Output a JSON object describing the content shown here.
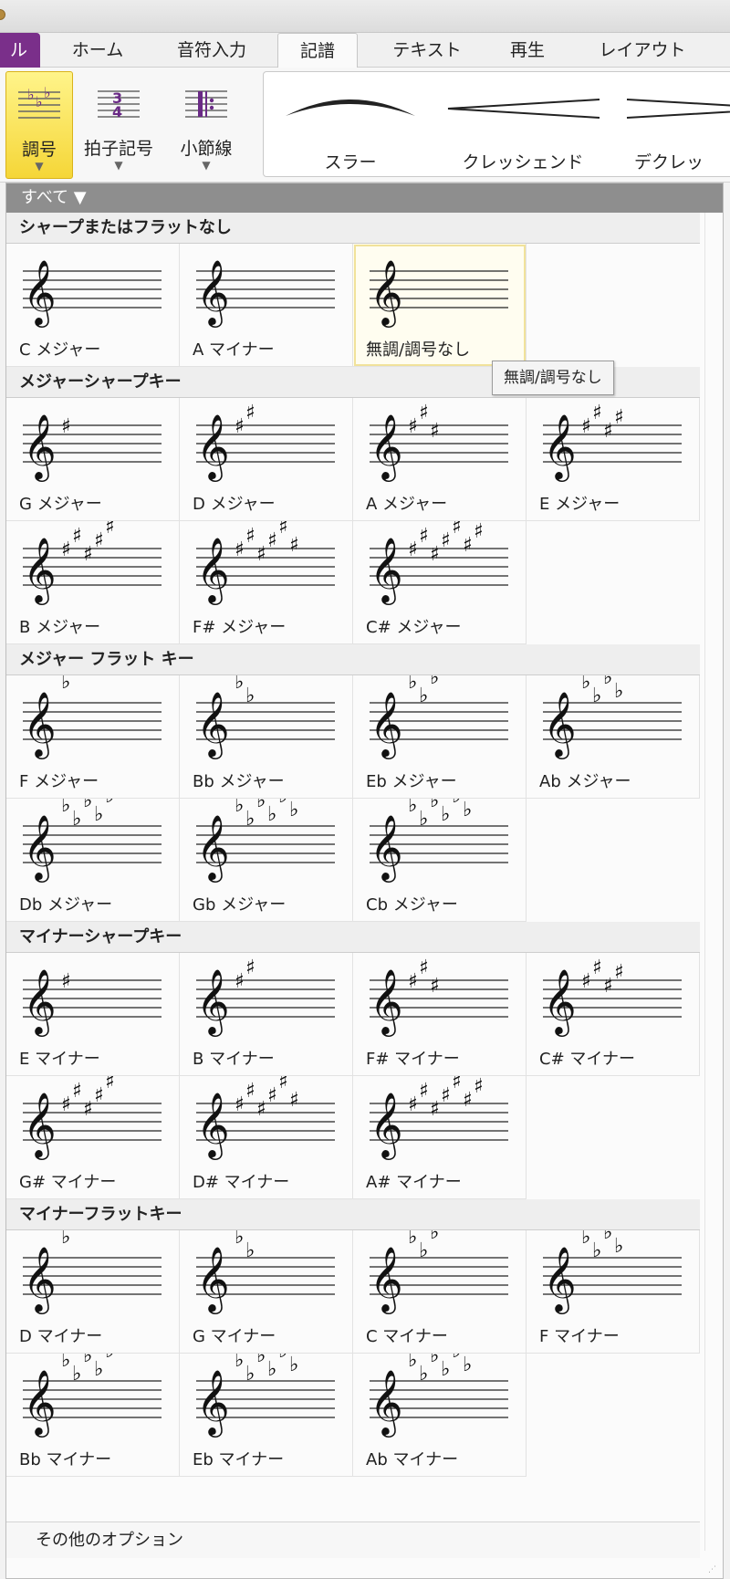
{
  "tabs": {
    "file_fragment": "ル",
    "home": "ホーム",
    "note_input": "音符入力",
    "notation": "記譜",
    "text": "テキスト",
    "play": "再生",
    "layout": "レイアウト"
  },
  "ribbon": {
    "key_signature": "調号",
    "time_signature": "拍子記号",
    "barline": "小節線",
    "slur": "スラー",
    "crescendo": "クレッシェンド",
    "decrescendo": "デクレッ"
  },
  "panel": {
    "filter_label": "すべて ▼",
    "tooltip": "無調/調号なし",
    "footer": "その他のオプション",
    "sections": [
      {
        "title": "シャープまたはフラットなし",
        "items": [
          {
            "label": "C メジャー",
            "type": "none",
            "count": 0
          },
          {
            "label": "A マイナー",
            "type": "none",
            "count": 0
          },
          {
            "label": "無調/調号なし",
            "type": "none",
            "count": 0,
            "selected": true
          }
        ]
      },
      {
        "title": "メジャーシャープキー",
        "items": [
          {
            "label": "G メジャー",
            "type": "sharp",
            "count": 1
          },
          {
            "label": "D メジャー",
            "type": "sharp",
            "count": 2
          },
          {
            "label": "A メジャー",
            "type": "sharp",
            "count": 3
          },
          {
            "label": "E メジャー",
            "type": "sharp",
            "count": 4
          },
          {
            "label": "B メジャー",
            "type": "sharp",
            "count": 5
          },
          {
            "label": "F# メジャー",
            "type": "sharp",
            "count": 6
          },
          {
            "label": "C# メジャー",
            "type": "sharp",
            "count": 7
          }
        ]
      },
      {
        "title": "メジャー フラット キー",
        "items": [
          {
            "label": "F メジャー",
            "type": "flat",
            "count": 1
          },
          {
            "label": "Bb メジャー",
            "type": "flat",
            "count": 2
          },
          {
            "label": "Eb メジャー",
            "type": "flat",
            "count": 3
          },
          {
            "label": "Ab メジャー",
            "type": "flat",
            "count": 4
          },
          {
            "label": "Db メジャー",
            "type": "flat",
            "count": 5
          },
          {
            "label": "Gb メジャー",
            "type": "flat",
            "count": 6
          },
          {
            "label": "Cb メジャー",
            "type": "flat",
            "count": 7
          }
        ]
      },
      {
        "title": "マイナーシャープキー",
        "items": [
          {
            "label": "E マイナー",
            "type": "sharp",
            "count": 1
          },
          {
            "label": "B マイナー",
            "type": "sharp",
            "count": 2
          },
          {
            "label": "F# マイナー",
            "type": "sharp",
            "count": 3
          },
          {
            "label": "C# マイナー",
            "type": "sharp",
            "count": 4
          },
          {
            "label": "G# マイナー",
            "type": "sharp",
            "count": 5
          },
          {
            "label": "D# マイナー",
            "type": "sharp",
            "count": 6
          },
          {
            "label": "A# マイナー",
            "type": "sharp",
            "count": 7
          }
        ]
      },
      {
        "title": "マイナーフラットキー",
        "items": [
          {
            "label": "D マイナー",
            "type": "flat",
            "count": 1
          },
          {
            "label": "G マイナー",
            "type": "flat",
            "count": 2
          },
          {
            "label": "C マイナー",
            "type": "flat",
            "count": 3
          },
          {
            "label": "F マイナー",
            "type": "flat",
            "count": 4
          },
          {
            "label": "Bb マイナー",
            "type": "flat",
            "count": 5
          },
          {
            "label": "Eb マイナー",
            "type": "flat",
            "count": 6
          },
          {
            "label": "Ab マイナー",
            "type": "flat",
            "count": 7
          }
        ]
      }
    ]
  },
  "colors": {
    "file_tab": "#7a2f8a",
    "active_button": "#f5d637",
    "filter_bar": "#8e8e8e"
  }
}
